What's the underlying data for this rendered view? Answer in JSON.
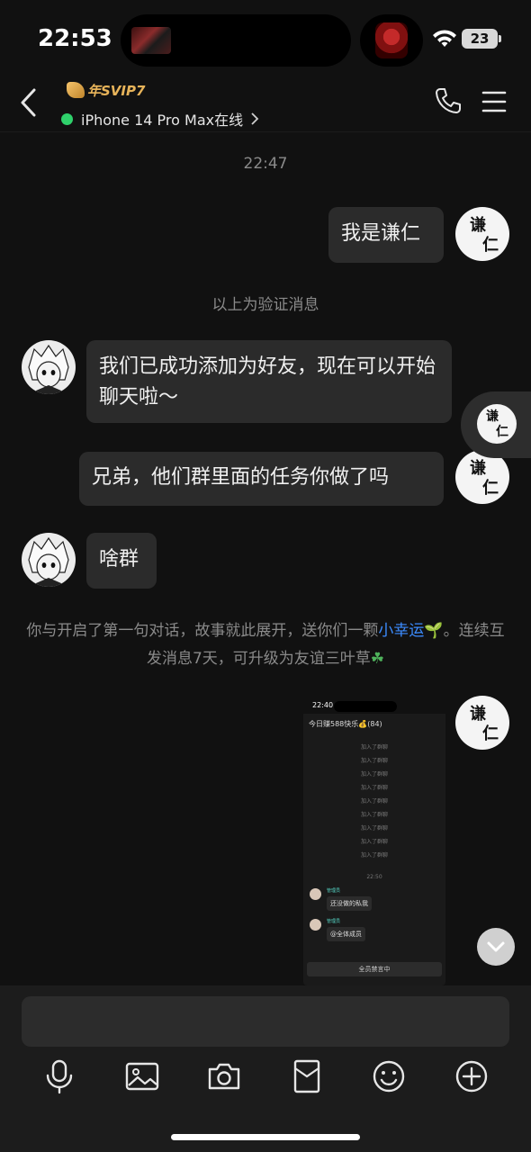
{
  "status_bar": {
    "time": "22:53",
    "battery": "23"
  },
  "header": {
    "svip_label": "年SVIP7",
    "device_status": "iPhone 14 Pro Max在线",
    "accent_online": "#2fd16b"
  },
  "chat": {
    "timestamp": "22:47",
    "messages": [
      {
        "side": "right",
        "avatar_text": "谦仁",
        "text": "我是谦仁"
      },
      {
        "side": "system",
        "text": "以上为验证消息"
      },
      {
        "side": "left",
        "text": "我们已成功添加为好友，现在可以开始聊天啦～"
      },
      {
        "side": "right",
        "avatar_text": "谦仁",
        "text": "兄弟，他们群里面的任务你做了吗"
      },
      {
        "side": "left",
        "text": "啥群"
      }
    ],
    "bonus_prefix": "你与开启了第一句对话，故事就此展开，送你们一颗",
    "bonus_link": "小幸运",
    "bonus_suffix": "。连续互发消息7天，可升级为友谊三叶草",
    "image_message": {
      "time": "22:40",
      "title": "今日赚588快乐💰(84)",
      "joined_lines": [
        "加入了群聊",
        "加入了群聊",
        "加入了群聊",
        "加入了群聊",
        "加入了群聊",
        "加入了群聊",
        "加入了群聊",
        "加入了群聊",
        "加入了群聊"
      ],
      "time2": "22:50",
      "msg1": "还没做的私我",
      "msg2": "@全体成员",
      "tag": "管理员",
      "mute_label": "全员禁言中"
    }
  },
  "input": {
    "placeholder": ""
  }
}
